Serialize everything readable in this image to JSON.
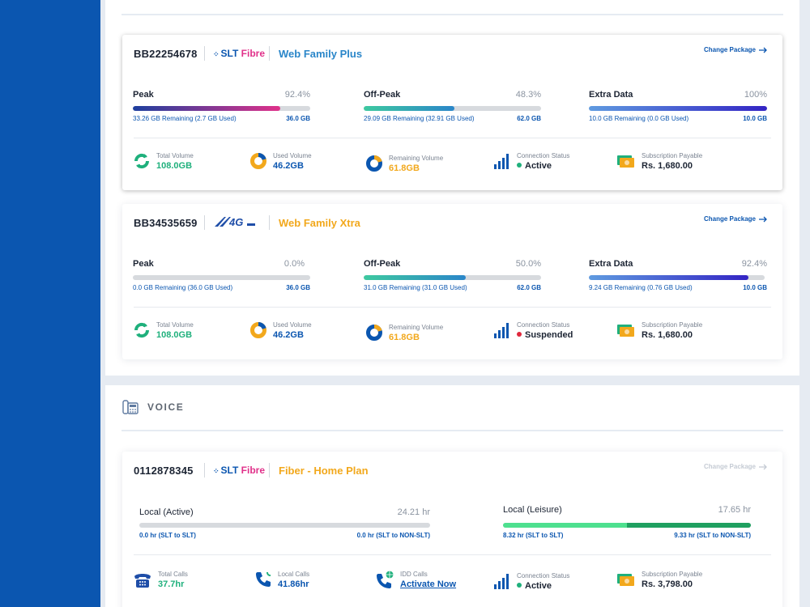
{
  "colors": {
    "brand_blue": "#0b56b0",
    "accent_green": "#1fb07c",
    "accent_orange": "#f2a81c",
    "status_active": "#1fb07c",
    "status_suspended": "#e0283c"
  },
  "broadband": [
    {
      "id": "BB22254678",
      "logo": {
        "slt": "SLT",
        "fibre": "Fibre"
      },
      "package": "Web Family Plus",
      "change_label": "Change Package",
      "meters": [
        {
          "label": "Peak",
          "pct": "92.4%",
          "sub": "33.26 GB Remaining (2.7 GB Used)",
          "total": "36.0 GB",
          "fill": 0.83
        },
        {
          "label": "Off-Peak",
          "pct": "48.3%",
          "sub": "29.09 GB Remaining (32.91 GB Used)",
          "total": "62.0 GB",
          "fill": 0.51
        },
        {
          "label": "Extra Data",
          "pct": "100%",
          "sub": "10.0 GB Remaining (0.0 GB Used)",
          "total": "10.0 GB",
          "fill": 1.0
        }
      ],
      "stats": {
        "total_volume": {
          "caption": "Total Volume",
          "value": "108.0GB"
        },
        "used_volume": {
          "caption": "Used Volume",
          "value": "46.2GB"
        },
        "remaining_volume": {
          "caption": "Remaining Volume",
          "value": "61.8GB"
        },
        "connection": {
          "caption": "Connection Status",
          "value": "Active"
        },
        "payable": {
          "caption": "Subscription Payable",
          "value": "Rs. 1,680.00"
        }
      }
    },
    {
      "id": "BB34535659",
      "logo": {
        "text": "4G"
      },
      "package": "Web Family Xtra",
      "change_label": "Change Package",
      "meters": [
        {
          "label": "Peak",
          "pct": "0.0%",
          "sub": "0.0 GB Remaining (36.0 GB Used)",
          "total": "36.0 GB",
          "fill": 0.0
        },
        {
          "label": "Off-Peak",
          "pct": "50.0%",
          "sub": "31.0 GB Remaining (31.0 GB Used)",
          "total": "62.0 GB",
          "fill": 0.575
        },
        {
          "label": "Extra Data",
          "pct": "92.4%",
          "sub": "9.24 GB Remaining (0.76 GB Used)",
          "total": "10.0 GB",
          "fill": 0.91
        }
      ],
      "stats": {
        "total_volume": {
          "caption": "Total Volume",
          "value": "108.0GB"
        },
        "used_volume": {
          "caption": "Used Volume",
          "value": "46.2GB"
        },
        "remaining_volume": {
          "caption": "Remaining Volume",
          "value": "61.8GB"
        },
        "connection": {
          "caption": "Connection Status",
          "value": "Suspended"
        },
        "payable": {
          "caption": "Subscription Payable",
          "value": "Rs. 1,680.00"
        }
      }
    }
  ],
  "voice": {
    "section_title": "VOICE",
    "account": {
      "id": "0112878345",
      "logo": {
        "slt": "SLT",
        "fibre": "Fibre"
      },
      "package": "Fiber - Home Plan",
      "change_label": "Change Package",
      "meters": [
        {
          "label": "Local (Active)",
          "value": "24.21 hr",
          "left": "0.0 hr (SLT to SLT)",
          "right": "0.0 hr (SLT to NON-SLT)",
          "split": 0.0,
          "fill": 0.0
        },
        {
          "label": "Local (Leisure)",
          "value": "17.65 hr",
          "left": "8.32 hr (SLT to SLT)",
          "right": "9.33 hr (SLT to NON-SLT)",
          "split": 0.5,
          "fill": 1.0
        }
      ],
      "stats": {
        "total_calls": {
          "caption": "Total Calls",
          "value": "37.7hr"
        },
        "local_calls": {
          "caption": "Local Calls",
          "value": "41.86hr"
        },
        "idd_calls": {
          "caption": "IDD Calls",
          "value": "Activate Now"
        },
        "connection": {
          "caption": "Connection Status",
          "value": "Active"
        },
        "payable": {
          "caption": "Subscription Payable",
          "value": "Rs. 3,798.00"
        }
      }
    }
  }
}
